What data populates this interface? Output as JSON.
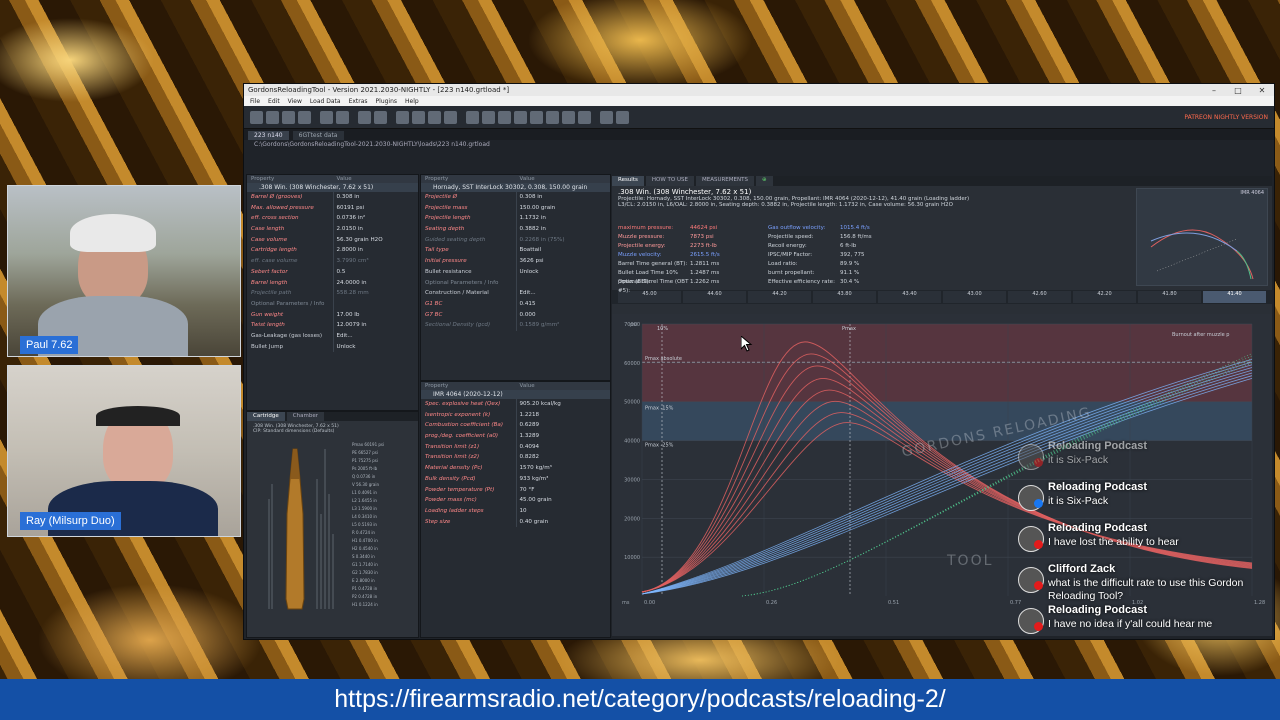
{
  "window": {
    "title": "GordonsReloadingTool - Version 2021.2030-NIGHTLY - [223 n140.grtload *]",
    "menu": [
      "File",
      "Edit",
      "View",
      "Load Data",
      "Extras",
      "Plugins",
      "Help"
    ],
    "patreon_label": "PATREON NIGHTLY VERSION",
    "tabs": [
      "223 n140",
      "6GTtest data"
    ],
    "path": "C:\\Gordons\\GordonsReloadingTool-2021.2030-NIGHTLY\\loads\\223 n140.grtload"
  },
  "cartridge_panel": {
    "header": [
      "Property",
      "Value"
    ],
    "section": ".308 Win. (308 Winchester, 7.62 x 51)",
    "rows": [
      {
        "k": "Barrel Ø (grooves)",
        "v": "0.308 in"
      },
      {
        "k": "Max. allowed pressure",
        "v": "60191 psi"
      },
      {
        "k": "eff. cross section",
        "v": "0.0736 in²"
      },
      {
        "k": "Case length",
        "v": "2.0150 in"
      },
      {
        "k": "Case volume",
        "v": "56.30 grain H2O"
      },
      {
        "k": "Cartridge length",
        "v": "2.8000 in"
      },
      {
        "k": "eff. case volume",
        "v": "3.7990 cm³",
        "dim": true
      },
      {
        "k": "Sebert factor",
        "v": "0.5"
      },
      {
        "k": "Barrel length",
        "v": "24.0000 in"
      },
      {
        "k": "Projectile path",
        "v": "558.28 mm",
        "dim": true
      },
      {
        "k": "Optional Parameters / Info",
        "v": "",
        "hdr": true
      },
      {
        "k": "Gun weight",
        "v": "17.00 lb"
      },
      {
        "k": "Twist length",
        "v": "12.0079 in"
      },
      {
        "k": "Gas-Leakage (gas losses)",
        "v": "Edit...",
        "plain": true
      },
      {
        "k": "Bullet Jump",
        "v": "Unlock",
        "plain": true
      }
    ]
  },
  "projectile_panel": {
    "header": [
      "Property",
      "Value"
    ],
    "section": "Hornady, SST InterLock 30302, 0.308, 150.00 grain",
    "rows": [
      {
        "k": "Projectile Ø",
        "v": "0.308 in"
      },
      {
        "k": "Projectile mass",
        "v": "150.00 grain"
      },
      {
        "k": "Projectile length",
        "v": "1.1732 in"
      },
      {
        "k": "Seating depth",
        "v": "0.3882 in"
      },
      {
        "k": "Guided seating depth",
        "v": "0.2268 in (75%)",
        "dim": true
      },
      {
        "k": "Tail type",
        "v": "Boattail"
      },
      {
        "k": "Initial pressure",
        "v": "3626 psi"
      },
      {
        "k": "Bullet resistance",
        "v": "Unlock",
        "plain": true
      },
      {
        "k": "Optional Parameters / Info",
        "v": "",
        "hdr": true
      },
      {
        "k": "Construction / Material",
        "v": "Edit...",
        "plain": true
      },
      {
        "k": "G1 BC",
        "v": "0.415"
      },
      {
        "k": "G7 BC",
        "v": "0.000"
      },
      {
        "k": "Sectional Density (gcd)",
        "v": "0.1589 g/mm²",
        "dim": true
      }
    ]
  },
  "powder_panel": {
    "header": [
      "Property",
      "Value"
    ],
    "section": "IMR 4064 (2020-12-12)",
    "rows": [
      {
        "k": "Spec. explosive heat (Qex)",
        "v": "905.20 kcal/kg"
      },
      {
        "k": "Isentropic exponent (k)",
        "v": "1.2218"
      },
      {
        "k": "Combustion coefficient (Ba)",
        "v": "0.6289"
      },
      {
        "k": "prog./deg. coefficient (a0)",
        "v": "1.3289"
      },
      {
        "k": "Transition limit (z1)",
        "v": "0.4094"
      },
      {
        "k": "Transition limit (z2)",
        "v": "0.8282"
      },
      {
        "k": "Material density (Pc)",
        "v": "1570 kg/m³"
      },
      {
        "k": "Bulk density (Pcd)",
        "v": "933 kg/m³"
      },
      {
        "k": "Powder temperature (Pt)",
        "v": "70 °F"
      },
      {
        "k": "Powder mass (mc)",
        "v": "45.00 grain"
      },
      {
        "k": "Loading ladder steps",
        "v": "10"
      },
      {
        "k": "Step size",
        "v": "0.40 grain"
      }
    ]
  },
  "cartridge_tabs": [
    "Cartridge",
    "Chamber"
  ],
  "cartridge_caption": ".308 Win. (308 Winchester, 7.62 x 51)\nCIP: Standard dimensions (Defaults)",
  "results": {
    "tabs": [
      "Results",
      "HOW TO USE",
      "MEASUREMENTS"
    ],
    "heading": ".308 Win. (308 Winchester, 7.62 x 51)",
    "line1": "Projectile: Hornady, SST InterLock 30302, 0.308, 150.00 grain, Propellant: IMR 4064 (2020-12-12), 41.40 grain (Loading ladder)",
    "line2": "L3/CL: 2.0150 in, L6/OAL: 2.8000 in, Seating depth: 0.3882 in, Projectile length: 1.1732 in, Case volume: 56.30 grain H2O",
    "left_stats": [
      {
        "k": "maximum pressure:",
        "v": "44624 psi",
        "c": "#ff7a7a"
      },
      {
        "k": "Muzzle pressure:",
        "v": "7873 psi",
        "c": "#ff9a9a"
      },
      {
        "k": "Projectile energy:",
        "v": "2273 ft-lb",
        "c": "#ff9a9a"
      },
      {
        "k": "Muzzle velocity:",
        "v": "2615.5 ft/s",
        "c": "#7aa0ff"
      },
      {
        "k": "Barrel Time general (BT):",
        "v": "1.2811 ms",
        "c": "#cfd5dc"
      },
      {
        "k": "Bullet Load Time 10% pmax (BLT):",
        "v": "1.2487 ms",
        "c": "#cfd5dc"
      },
      {
        "k": "Optimal Barrel Time (OBT #5):",
        "v": "1.2262 ms",
        "c": "#cfd5dc"
      }
    ],
    "right_stats": [
      {
        "k": "Gas outflow velocity:",
        "v": "1015.4 ft/s",
        "c": "#7aa0ff"
      },
      {
        "k": "Projectile speed:",
        "v": "156.8 ft/ms",
        "c": "#cfd5dc"
      },
      {
        "k": "Recoil energy:",
        "v": "6 ft-lb",
        "c": "#cfd5dc"
      },
      {
        "k": "IPSC/MIP Factor:",
        "v": "392, 775",
        "c": "#cfd5dc"
      },
      {
        "k": "Load ratio:",
        "v": "89.9 %",
        "c": "#cfd5dc"
      },
      {
        "k": "burnt propellant:",
        "v": "91.1 %",
        "c": "#cfd5dc"
      },
      {
        "k": "Effective efficiency rate:",
        "v": "30.4 %",
        "c": "#cfd5dc"
      }
    ],
    "mini_chart_label": "IMR 4064",
    "ladder": [
      "45.00",
      "44.60",
      "44.20",
      "43.80",
      "43.40",
      "43.00",
      "42.60",
      "42.20",
      "41.80",
      "41.40"
    ],
    "ladder_selected": "41.40"
  },
  "chart_data": {
    "type": "line",
    "xlabel": "ms",
    "ylabel": "psi",
    "x_ticks": [
      "0.00",
      "0.26",
      "0.51",
      "0.77",
      "1.02",
      "1.28"
    ],
    "y_ticks": [
      "70000",
      "60000",
      "50000",
      "40000",
      "30000",
      "20000",
      "10000"
    ],
    "ylim": [
      0,
      70000
    ],
    "annotations": [
      "10%",
      "Pmax",
      "Burnout after muzzle p",
      "Pmax absolute",
      "Pmax -15%",
      "Pmax -25%"
    ],
    "watermark": [
      "GORDONS RELOADING",
      "TOOL"
    ],
    "pressure_peaks": [
      44624,
      47200,
      50100,
      53000,
      56000,
      59200,
      62300,
      65400
    ],
    "colors": {
      "pressure": "#e06060",
      "velocity": "#7fb8ff",
      "burn": "#4fc08a",
      "band_red": "#7a3b46",
      "band_blue": "#3c5874"
    }
  },
  "webcams": [
    {
      "name": "Paul 7.62"
    },
    {
      "name": "Ray (Milsurp Duo)"
    }
  ],
  "chat": [
    {
      "name": "Reloading Podcast",
      "text": "it is Six-Pack",
      "badge": "yt",
      "faded": true
    },
    {
      "name": "Reloading Podcast",
      "text": "it is Six-Pack",
      "badge": "fb"
    },
    {
      "name": "Reloading Podcast",
      "text": "I have lost the ability to hear",
      "badge": "yt"
    },
    {
      "name": "Clifford Zack",
      "text": "what is the difficult rate to use this Gordon Reloading Tool?",
      "badge": "yt"
    },
    {
      "name": "Reloading Podcast",
      "text": "I have no idea if y'all could hear me",
      "badge": "yt"
    }
  ],
  "banner_url": "https://firearmsradio.net/category/podcasts/reloading-2/"
}
